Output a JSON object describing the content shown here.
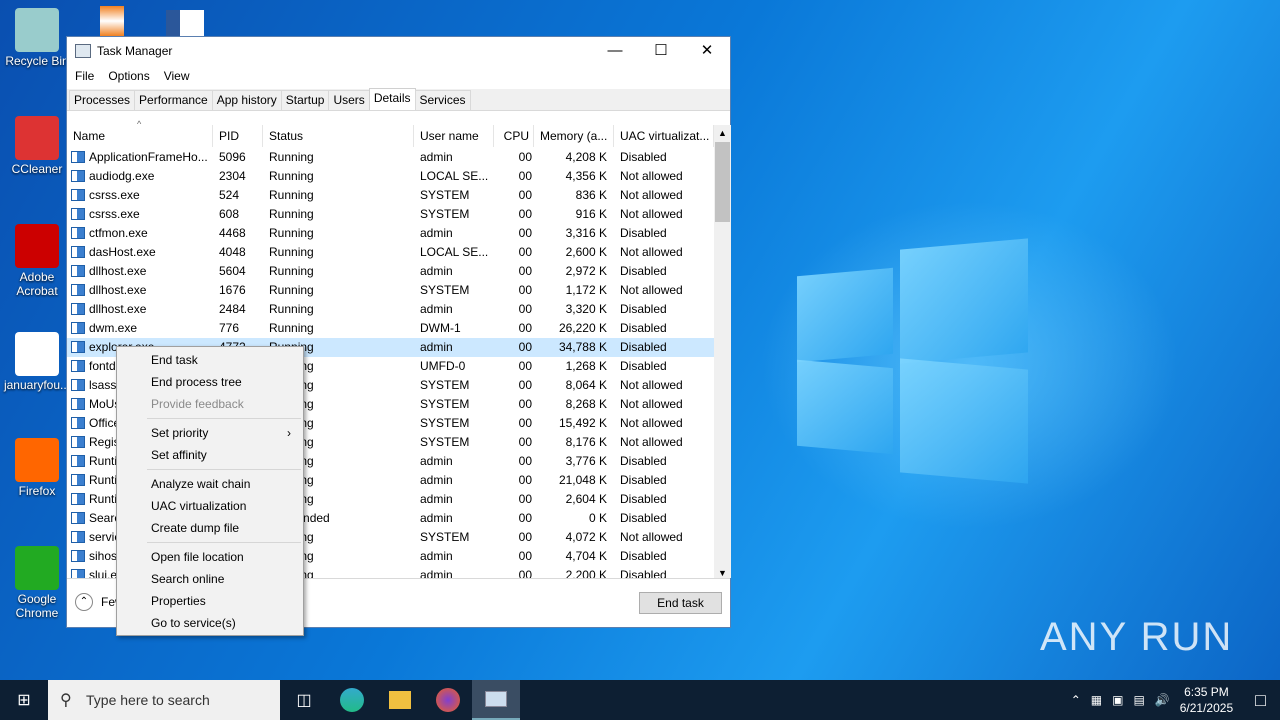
{
  "desktop": {
    "icons": [
      {
        "label": "Recycle Bin"
      },
      {
        "label": "CCleaner"
      },
      {
        "label": "Adobe Acrobat"
      },
      {
        "label": "januaryfou..."
      },
      {
        "label": "Firefox"
      },
      {
        "label": "Google Chrome"
      }
    ],
    "watermark": "ANY RUN"
  },
  "window": {
    "title": "Task Manager",
    "menu": [
      "File",
      "Options",
      "View"
    ],
    "tabs": [
      "Processes",
      "Performance",
      "App history",
      "Startup",
      "Users",
      "Details",
      "Services"
    ],
    "columns": [
      "Name",
      "PID",
      "Status",
      "User name",
      "CPU",
      "Memory (a...",
      "UAC virtualizat..."
    ],
    "rows": [
      [
        "ApplicationFrameHo...",
        "5096",
        "Running",
        "admin",
        "00",
        "4,208 K",
        "Disabled"
      ],
      [
        "audiodg.exe",
        "2304",
        "Running",
        "LOCAL SE...",
        "00",
        "4,356 K",
        "Not allowed"
      ],
      [
        "csrss.exe",
        "524",
        "Running",
        "SYSTEM",
        "00",
        "836 K",
        "Not allowed"
      ],
      [
        "csrss.exe",
        "608",
        "Running",
        "SYSTEM",
        "00",
        "916 K",
        "Not allowed"
      ],
      [
        "ctfmon.exe",
        "4468",
        "Running",
        "admin",
        "00",
        "3,316 K",
        "Disabled"
      ],
      [
        "dasHost.exe",
        "4048",
        "Running",
        "LOCAL SE...",
        "00",
        "2,600 K",
        "Not allowed"
      ],
      [
        "dllhost.exe",
        "5604",
        "Running",
        "admin",
        "00",
        "2,972 K",
        "Disabled"
      ],
      [
        "dllhost.exe",
        "1676",
        "Running",
        "SYSTEM",
        "00",
        "1,172 K",
        "Not allowed"
      ],
      [
        "dllhost.exe",
        "2484",
        "Running",
        "admin",
        "00",
        "3,320 K",
        "Disabled"
      ],
      [
        "dwm.exe",
        "776",
        "Running",
        "DWM-1",
        "00",
        "26,220 K",
        "Disabled"
      ],
      [
        "explorer.exe",
        "4772",
        "Running",
        "admin",
        "00",
        "34,788 K",
        "Disabled"
      ],
      [
        "fontdrvhost.exe",
        "",
        "Running",
        "UMFD-0",
        "00",
        "1,268 K",
        "Disabled"
      ],
      [
        "lsass.exe",
        "",
        "Running",
        "SYSTEM",
        "00",
        "8,064 K",
        "Not allowed"
      ],
      [
        "MoUsoCoreWorker.exe",
        "",
        "Running",
        "SYSTEM",
        "00",
        "8,268 K",
        "Not allowed"
      ],
      [
        "OfficeClickToRun.exe",
        "",
        "Running",
        "SYSTEM",
        "00",
        "15,492 K",
        "Not allowed"
      ],
      [
        "Registry",
        "",
        "Running",
        "SYSTEM",
        "00",
        "8,176 K",
        "Not allowed"
      ],
      [
        "RuntimeBroker.exe",
        "",
        "Running",
        "admin",
        "00",
        "3,776 K",
        "Disabled"
      ],
      [
        "RuntimeBroker.exe",
        "",
        "Running",
        "admin",
        "00",
        "21,048 K",
        "Disabled"
      ],
      [
        "RuntimeBroker.exe",
        "",
        "Running",
        "admin",
        "00",
        "2,604 K",
        "Disabled"
      ],
      [
        "SearchApp.exe",
        "",
        "Suspended",
        "admin",
        "00",
        "0 K",
        "Disabled"
      ],
      [
        "services.exe",
        "",
        "Running",
        "SYSTEM",
        "00",
        "4,072 K",
        "Not allowed"
      ],
      [
        "sihost.exe",
        "",
        "Running",
        "admin",
        "00",
        "4,704 K",
        "Disabled"
      ],
      [
        "slui.exe",
        "",
        "Running",
        "admin",
        "00",
        "2,200 K",
        "Disabled"
      ]
    ],
    "selected_row": 10,
    "fewer_details": "Fewer details",
    "end_task": "End task"
  },
  "context_menu": [
    [
      "End task"
    ],
    [
      "End process tree"
    ],
    [
      "Provide feedback",
      "disabled"
    ],
    [
      "-"
    ],
    [
      "Set priority",
      "submenu"
    ],
    [
      "Set affinity"
    ],
    [
      "-"
    ],
    [
      "Analyze wait chain"
    ],
    [
      "UAC virtualization"
    ],
    [
      "Create dump file"
    ],
    [
      "-"
    ],
    [
      "Open file location"
    ],
    [
      "Search online"
    ],
    [
      "Properties"
    ],
    [
      "Go to service(s)"
    ]
  ],
  "taskbar": {
    "search_placeholder": "Type here to search",
    "time": "6:35 PM",
    "date": "6/21/2025"
  }
}
